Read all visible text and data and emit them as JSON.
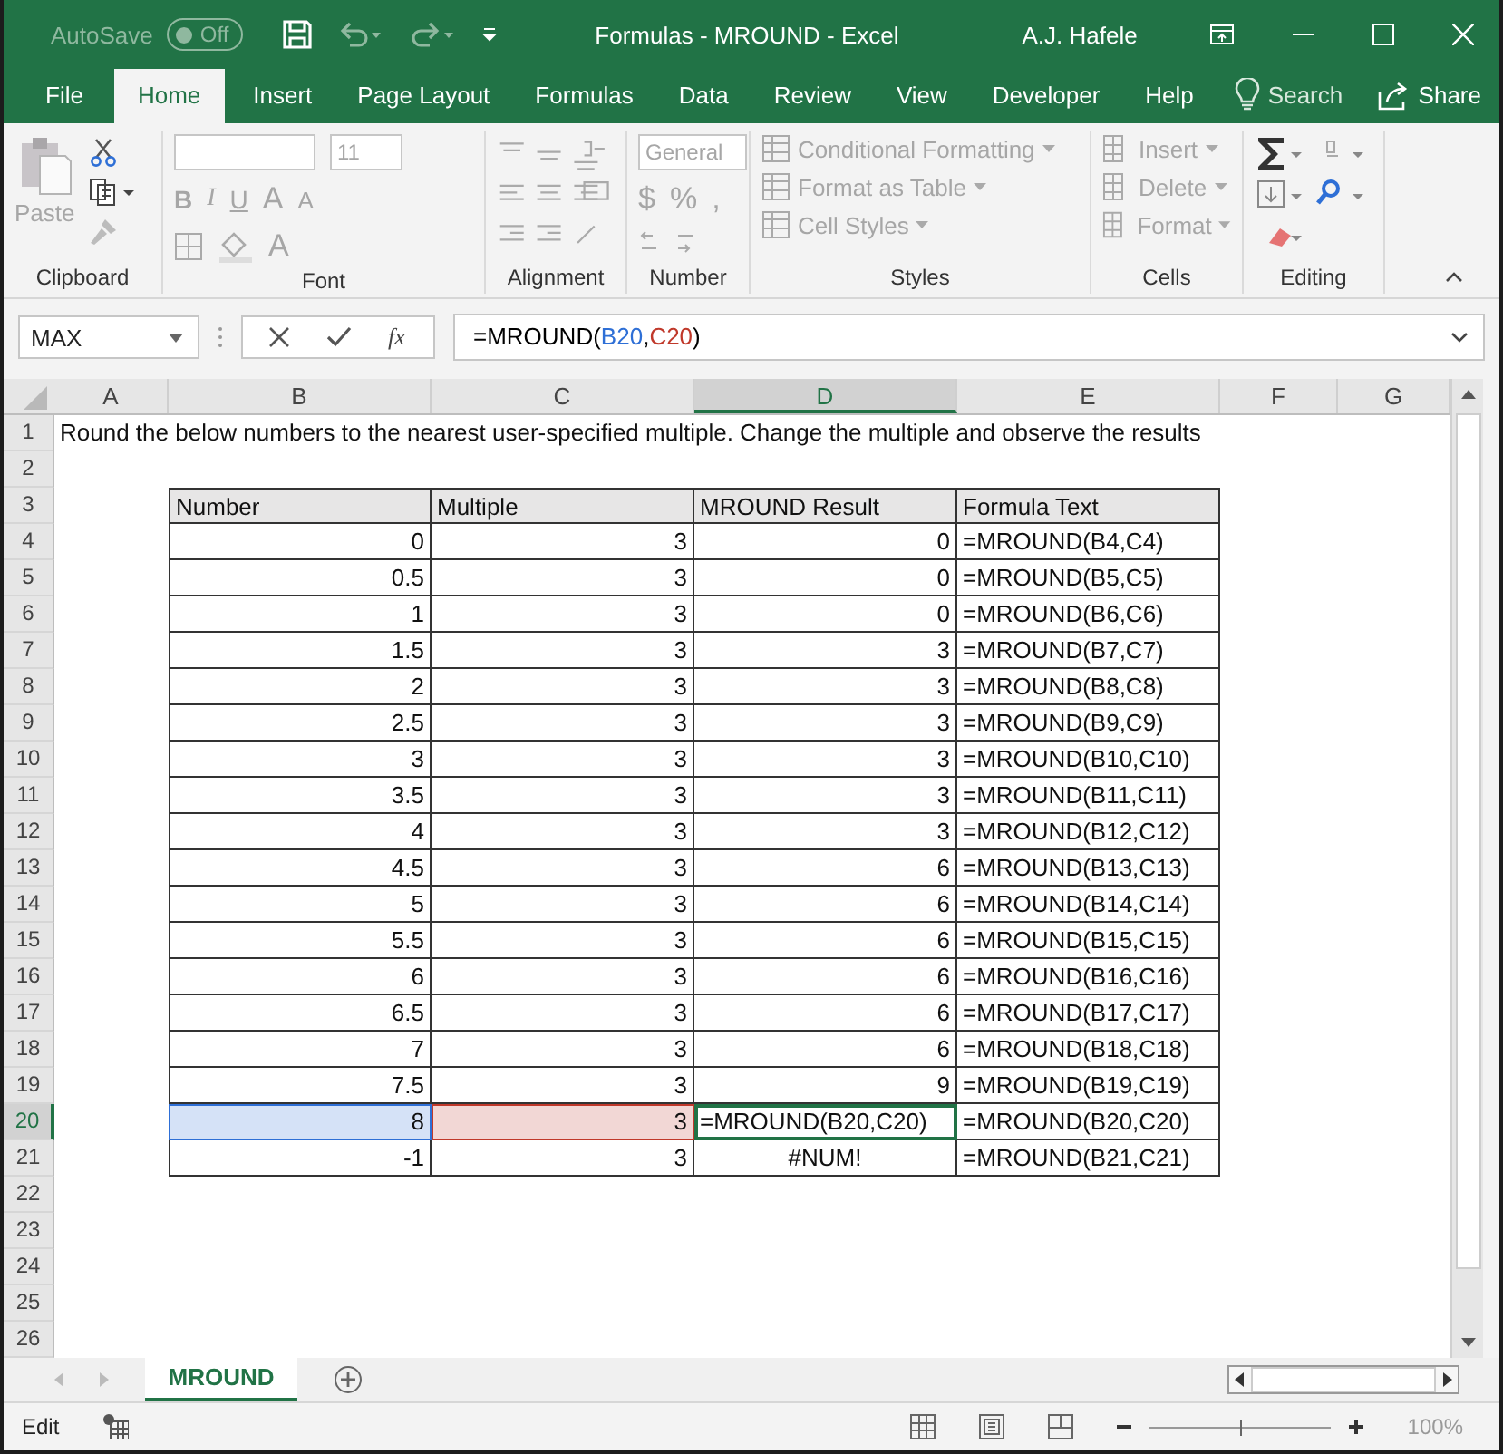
{
  "title_bar": {
    "autosave_label": "AutoSave",
    "autosave_state": "Off",
    "autosave_on": false,
    "title": "Formulas - MROUND  -  Excel",
    "user": "A.J. Hafele"
  },
  "menu_tabs": [
    {
      "label": "File",
      "selected": false
    },
    {
      "label": "Home",
      "selected": true
    },
    {
      "label": "Insert",
      "selected": false
    },
    {
      "label": "Page Layout",
      "selected": false
    },
    {
      "label": "Formulas",
      "selected": false
    },
    {
      "label": "Data",
      "selected": false
    },
    {
      "label": "Review",
      "selected": false
    },
    {
      "label": "View",
      "selected": false
    },
    {
      "label": "Developer",
      "selected": false
    },
    {
      "label": "Help",
      "selected": false
    }
  ],
  "search": "Search",
  "share": "Share",
  "ribbon": {
    "clipboard": {
      "paste": "Paste",
      "label": "Clipboard"
    },
    "font": {
      "size": "11",
      "styles": [
        "B",
        "I",
        "U"
      ],
      "grow": "A",
      "shrink": "A",
      "color_letter": "A",
      "label": "Font"
    },
    "alignment": {
      "label": "Alignment"
    },
    "number": {
      "format": "General",
      "symbols": [
        "$",
        "%",
        ","
      ],
      "label": "Number"
    },
    "styles": {
      "items": [
        "Conditional Formatting",
        "Format as Table",
        "Cell Styles"
      ],
      "label": "Styles"
    },
    "cells": {
      "items": [
        "Insert",
        "Delete",
        "Format"
      ],
      "label": "Cells"
    },
    "editing": {
      "label": "Editing"
    }
  },
  "formula_bar": {
    "name_box": "MAX",
    "fx": "fx",
    "parts": [
      {
        "text": "=MROUND(",
        "color": "#000000"
      },
      {
        "text": "B20",
        "color": "#2e6fd6"
      },
      {
        "separator": ",",
        "text": "C20",
        "color": "#c0392b"
      },
      {
        "text": ")",
        "color": "#000000"
      }
    ]
  },
  "sheet": {
    "columns": [
      {
        "label": "A",
        "selected": false
      },
      {
        "label": "B",
        "selected": false
      },
      {
        "label": "C",
        "selected": false
      },
      {
        "label": "D",
        "selected": true
      },
      {
        "label": "E",
        "selected": false
      },
      {
        "label": "F",
        "selected": false
      },
      {
        "label": "G",
        "selected": false
      }
    ],
    "rows": [
      {
        "n": "1",
        "selected": false,
        "cells": {
          "a": {
            "text": "Round the below numbers to the nearest user-specified multiple. Change the multiple and observe the results",
            "kind": "note"
          }
        }
      },
      {
        "n": "2",
        "selected": false
      },
      {
        "n": "3",
        "selected": false,
        "cells": {
          "b": {
            "text": "Number",
            "kind": "header"
          },
          "c": {
            "text": "Multiple",
            "kind": "header"
          },
          "d": {
            "text": "MROUND Result",
            "kind": "header"
          },
          "e": {
            "text": "Formula Text",
            "kind": "header"
          }
        }
      },
      {
        "n": "4",
        "selected": false,
        "cells": {
          "b": {
            "text": "0",
            "kind": "number"
          },
          "c": {
            "text": "3",
            "kind": "number"
          },
          "d": {
            "text": "0",
            "kind": "number"
          },
          "e": {
            "text": "=MROUND(B4,C4)",
            "kind": "text"
          }
        }
      },
      {
        "n": "5",
        "selected": false,
        "cells": {
          "b": {
            "text": "0.5",
            "kind": "number"
          },
          "c": {
            "text": "3",
            "kind": "number"
          },
          "d": {
            "text": "0",
            "kind": "number"
          },
          "e": {
            "text": "=MROUND(B5,C5)",
            "kind": "text"
          }
        }
      },
      {
        "n": "6",
        "selected": false,
        "cells": {
          "b": {
            "text": "1",
            "kind": "number"
          },
          "c": {
            "text": "3",
            "kind": "number"
          },
          "d": {
            "text": "0",
            "kind": "number"
          },
          "e": {
            "text": "=MROUND(B6,C6)",
            "kind": "text"
          }
        }
      },
      {
        "n": "7",
        "selected": false,
        "cells": {
          "b": {
            "text": "1.5",
            "kind": "number"
          },
          "c": {
            "text": "3",
            "kind": "number"
          },
          "d": {
            "text": "3",
            "kind": "number"
          },
          "e": {
            "text": "=MROUND(B7,C7)",
            "kind": "text"
          }
        }
      },
      {
        "n": "8",
        "selected": false,
        "cells": {
          "b": {
            "text": "2",
            "kind": "number"
          },
          "c": {
            "text": "3",
            "kind": "number"
          },
          "d": {
            "text": "3",
            "kind": "number"
          },
          "e": {
            "text": "=MROUND(B8,C8)",
            "kind": "text"
          }
        }
      },
      {
        "n": "9",
        "selected": false,
        "cells": {
          "b": {
            "text": "2.5",
            "kind": "number"
          },
          "c": {
            "text": "3",
            "kind": "number"
          },
          "d": {
            "text": "3",
            "kind": "number"
          },
          "e": {
            "text": "=MROUND(B9,C9)",
            "kind": "text"
          }
        }
      },
      {
        "n": "10",
        "selected": false,
        "cells": {
          "b": {
            "text": "3",
            "kind": "number"
          },
          "c": {
            "text": "3",
            "kind": "number"
          },
          "d": {
            "text": "3",
            "kind": "number"
          },
          "e": {
            "text": "=MROUND(B10,C10)",
            "kind": "text"
          }
        }
      },
      {
        "n": "11",
        "selected": false,
        "cells": {
          "b": {
            "text": "3.5",
            "kind": "number"
          },
          "c": {
            "text": "3",
            "kind": "number"
          },
          "d": {
            "text": "3",
            "kind": "number"
          },
          "e": {
            "text": "=MROUND(B11,C11)",
            "kind": "text"
          }
        }
      },
      {
        "n": "12",
        "selected": false,
        "cells": {
          "b": {
            "text": "4",
            "kind": "number"
          },
          "c": {
            "text": "3",
            "kind": "number"
          },
          "d": {
            "text": "3",
            "kind": "number"
          },
          "e": {
            "text": "=MROUND(B12,C12)",
            "kind": "text"
          }
        }
      },
      {
        "n": "13",
        "selected": false,
        "cells": {
          "b": {
            "text": "4.5",
            "kind": "number"
          },
          "c": {
            "text": "3",
            "kind": "number"
          },
          "d": {
            "text": "6",
            "kind": "number"
          },
          "e": {
            "text": "=MROUND(B13,C13)",
            "kind": "text"
          }
        }
      },
      {
        "n": "14",
        "selected": false,
        "cells": {
          "b": {
            "text": "5",
            "kind": "number"
          },
          "c": {
            "text": "3",
            "kind": "number"
          },
          "d": {
            "text": "6",
            "kind": "number"
          },
          "e": {
            "text": "=MROUND(B14,C14)",
            "kind": "text"
          }
        }
      },
      {
        "n": "15",
        "selected": false,
        "cells": {
          "b": {
            "text": "5.5",
            "kind": "number"
          },
          "c": {
            "text": "3",
            "kind": "number"
          },
          "d": {
            "text": "6",
            "kind": "number"
          },
          "e": {
            "text": "=MROUND(B15,C15)",
            "kind": "text"
          }
        }
      },
      {
        "n": "16",
        "selected": false,
        "cells": {
          "b": {
            "text": "6",
            "kind": "number"
          },
          "c": {
            "text": "3",
            "kind": "number"
          },
          "d": {
            "text": "6",
            "kind": "number"
          },
          "e": {
            "text": "=MROUND(B16,C16)",
            "kind": "text"
          }
        }
      },
      {
        "n": "17",
        "selected": false,
        "cells": {
          "b": {
            "text": "6.5",
            "kind": "number"
          },
          "c": {
            "text": "3",
            "kind": "number"
          },
          "d": {
            "text": "6",
            "kind": "number"
          },
          "e": {
            "text": "=MROUND(B17,C17)",
            "kind": "text"
          }
        }
      },
      {
        "n": "18",
        "selected": false,
        "cells": {
          "b": {
            "text": "7",
            "kind": "number"
          },
          "c": {
            "text": "3",
            "kind": "number"
          },
          "d": {
            "text": "6",
            "kind": "number"
          },
          "e": {
            "text": "=MROUND(B18,C18)",
            "kind": "text"
          }
        }
      },
      {
        "n": "19",
        "selected": false,
        "cells": {
          "b": {
            "text": "7.5",
            "kind": "number"
          },
          "c": {
            "text": "3",
            "kind": "number"
          },
          "d": {
            "text": "9",
            "kind": "number"
          },
          "e": {
            "text": "=MROUND(B19,C19)",
            "kind": "text"
          }
        }
      },
      {
        "n": "20",
        "selected": true,
        "cells": {
          "b": {
            "text": "8",
            "kind": "number",
            "color": "#2e6fd6"
          },
          "c": {
            "text": "3",
            "kind": "number",
            "color": "#c0392b"
          },
          "d": {
            "text": "=MROUND(B20,C20)",
            "kind": "editing"
          },
          "e": {
            "text": "=MROUND(B20,C20)",
            "kind": "text"
          }
        }
      },
      {
        "n": "21",
        "selected": false,
        "cells": {
          "b": {
            "text": "-1",
            "kind": "number"
          },
          "c": {
            "text": "3",
            "kind": "number"
          },
          "d": {
            "text": "#NUM!",
            "kind": "error"
          },
          "e": {
            "text": "=MROUND(B21,C21)",
            "kind": "text"
          }
        }
      },
      {
        "n": "22",
        "selected": false
      },
      {
        "n": "23",
        "selected": false
      },
      {
        "n": "24",
        "selected": false
      },
      {
        "n": "25",
        "selected": false
      },
      {
        "n": "26",
        "selected": false
      }
    ]
  },
  "sheet_tabs": [
    {
      "label": "MROUND",
      "selected": true
    }
  ],
  "status_bar": {
    "mode": "Edit",
    "zoom": "100%",
    "zoom_slider": {
      "level": 0.5
    }
  }
}
